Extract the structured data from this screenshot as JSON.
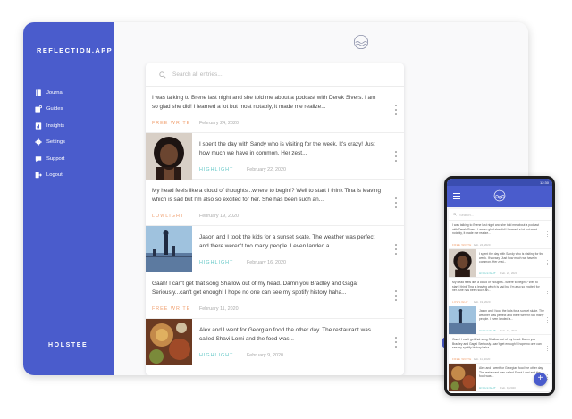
{
  "colors": {
    "brand": "#4a5ccc",
    "free_write": "#f0a070",
    "highlight": "#5fc6c5",
    "lowlight": "#f0a070"
  },
  "sidebar": {
    "brand": "REFLECTION.APP",
    "items": [
      {
        "label": "Journal",
        "icon": "journal-icon"
      },
      {
        "label": "Guides",
        "icon": "guides-icon"
      },
      {
        "label": "Insights",
        "icon": "insights-icon"
      },
      {
        "label": "Settings",
        "icon": "gear-icon"
      },
      {
        "label": "Support",
        "icon": "chat-icon"
      },
      {
        "label": "Logout",
        "icon": "logout-icon"
      }
    ],
    "footer": "HOLSTEE"
  },
  "search": {
    "placeholder": "Search all entries..."
  },
  "entries": [
    {
      "text": "I was talking to Brene last night and she told me about a podcast with Derek Sivers. I am so glad she did! I learned a lot but most notably, it made me realize...",
      "tag": "FREE WRITE",
      "date": "February 24, 2020"
    },
    {
      "text": "I spent the day with Sandy who is visiting for the week. It's crazy! Just how much we have in common. Her zest...",
      "tag": "HIGHLIGHT",
      "date": "February 22, 2020"
    },
    {
      "text": "My head feels like a cloud of thoughts...where to begin!? Well to start I think Tina is leaving which is sad but I'm also so excited for her. She has been such an...",
      "tag": "LOWLIGHT",
      "date": "February 19, 2020"
    },
    {
      "text": "Jason and I took the kids for a sunset skate. The weather was perfect and there weren't too many people. I even landed a...",
      "tag": "HIGHLIGHT",
      "date": "February 16, 2020"
    },
    {
      "text": "Gaah! I can't get that song Shallow out of my head. Damn you Bradley and Gaga! Seriously...can't get enough! I hope no one can see my spotify history haha...",
      "tag": "FREE WRITE",
      "date": "February 11, 2020"
    },
    {
      "text": "Alex and I went for Georgian food the other day. The restaurant was called Shavi Lomi and the food was...",
      "tag": "HIGHLIGHT",
      "date": "February 9, 2020"
    }
  ],
  "phone": {
    "time": "12:30",
    "search_placeholder": "Search...",
    "entries": [
      {
        "text": "I was talking to Brene last night and she told me about a podcast with Derek Sivers. I am so glad she did! I learned a lot but most notably, it made me realize...",
        "tag": "FREE WRITE",
        "date": "Feb. 24, 2020"
      },
      {
        "text": "I spent the day with Sandy who is visiting for the week. It's crazy! Just how much we have in common. Her zest...",
        "tag": "HIGHLIGHT",
        "date": "Feb. 22, 2020"
      },
      {
        "text": "My head feels like a cloud of thoughts...where to begin!? Well to start I think Tina is leaving which is sad but I'm also so excited for her. She has been such an...",
        "tag": "LOWLIGHT",
        "date": "Feb. 19, 2020"
      },
      {
        "text": "Jason and I took the kids for a sunset skate. The weather was perfect and there weren't too many people. I even landed a...",
        "tag": "HIGHLIGHT",
        "date": "Feb. 16, 2020"
      },
      {
        "text": "Gaah! I can't get that song Shallow out of my head. Damn you Bradley and Gaga! Seriously...can't get enough! I hope no one can see my spotify history haha...",
        "tag": "FREE WRITE",
        "date": "Feb. 11, 2020"
      },
      {
        "text": "Alex and I went for Georgian food the other day. The restaurant was called Shavi Lomi and the food was...",
        "tag": "HIGHLIGHT",
        "date": "Feb. 9, 2020"
      }
    ],
    "fab_label": "+"
  }
}
